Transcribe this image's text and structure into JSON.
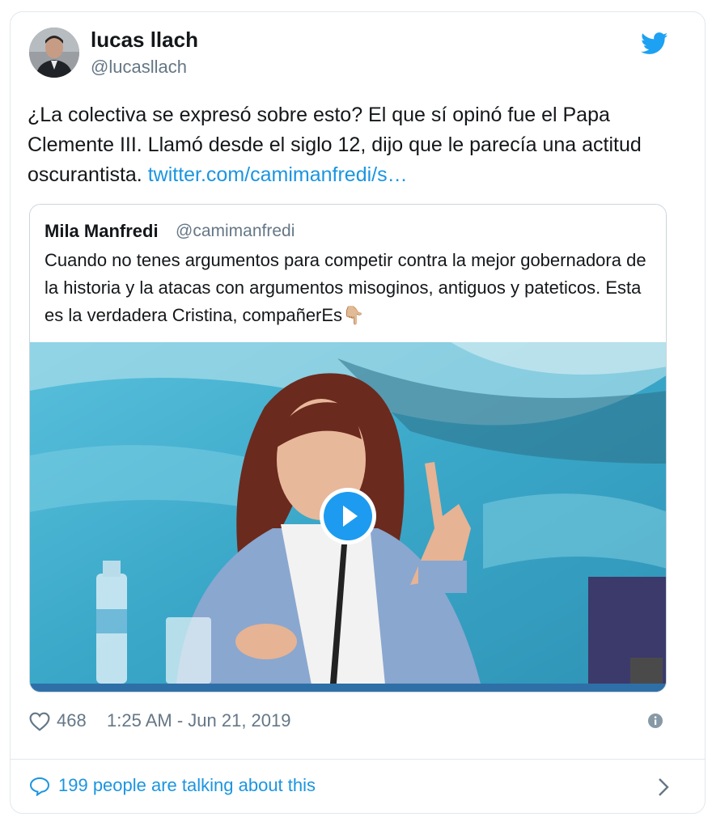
{
  "author": {
    "name": "lucas llach",
    "handle": "@lucasllach"
  },
  "tweet": {
    "text": "¿La colectiva se expresó sobre esto? El que sí opinó fue el Papa Clemente III. Llamó desde el siglo 12, dijo que le parecía una actitud oscurantista. ",
    "link_text": "twitter.com/camimanfredi/s…"
  },
  "quote": {
    "name": "Mila Manfredi",
    "handle": "@camimanfredi",
    "text": "Cuando no tenes argumentos para competir contra la mejor gobernadora de la historia y la atacas con argumentos misoginos, antiguos y pateticos. Esta es la verdadera Cristina, compañerEs",
    "emoji": "👇🏼"
  },
  "meta": {
    "likes": "468",
    "timestamp": "1:25 AM - Jun 21, 2019"
  },
  "footer": {
    "talking": "199 people are talking about this"
  },
  "colors": {
    "accent": "#1b95e0",
    "muted": "#657786",
    "border": "#e1e8ed"
  },
  "icons": [
    "twitter-bird-icon",
    "heart-icon",
    "info-icon",
    "comment-bubble-icon",
    "chevron-right-icon",
    "play-icon"
  ]
}
